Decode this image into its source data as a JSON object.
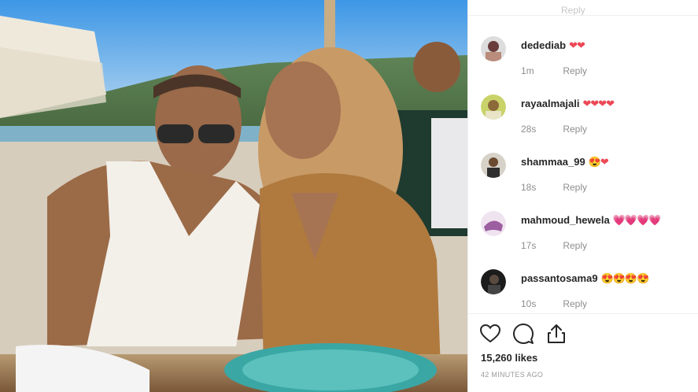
{
  "photo": {
    "description_icon": "post-photo"
  },
  "top_partial": {
    "text": "Reply"
  },
  "comments": [
    {
      "username": "dedediab",
      "emoji": "❤❤",
      "time": "1m",
      "reply": "Reply",
      "avatar_color": "#6a3c3c"
    },
    {
      "username": "rayaalmajali",
      "emoji": "❤❤❤❤",
      "time": "28s",
      "reply": "Reply",
      "avatar_color": "#8c6a3a"
    },
    {
      "username": "shammaa_99",
      "emoji": "😍❤",
      "time": "18s",
      "reply": "Reply",
      "avatar_color": "#3d3d3d"
    },
    {
      "username": "mahmoud_hewela",
      "emoji": "💗💗💗💗",
      "time": "17s",
      "reply": "Reply",
      "avatar_color": "#9c5fa0"
    },
    {
      "username": "passantosama9",
      "emoji": "😍😍😍😍",
      "time": "10s",
      "reply": "Reply",
      "avatar_color": "#2b2b2b"
    }
  ],
  "actions": {
    "likes": "15,260 likes",
    "time_ago": "42 MINUTES AGO"
  },
  "colors": {
    "heart_red": "#ed4956",
    "muted": "#8e8e8e"
  }
}
